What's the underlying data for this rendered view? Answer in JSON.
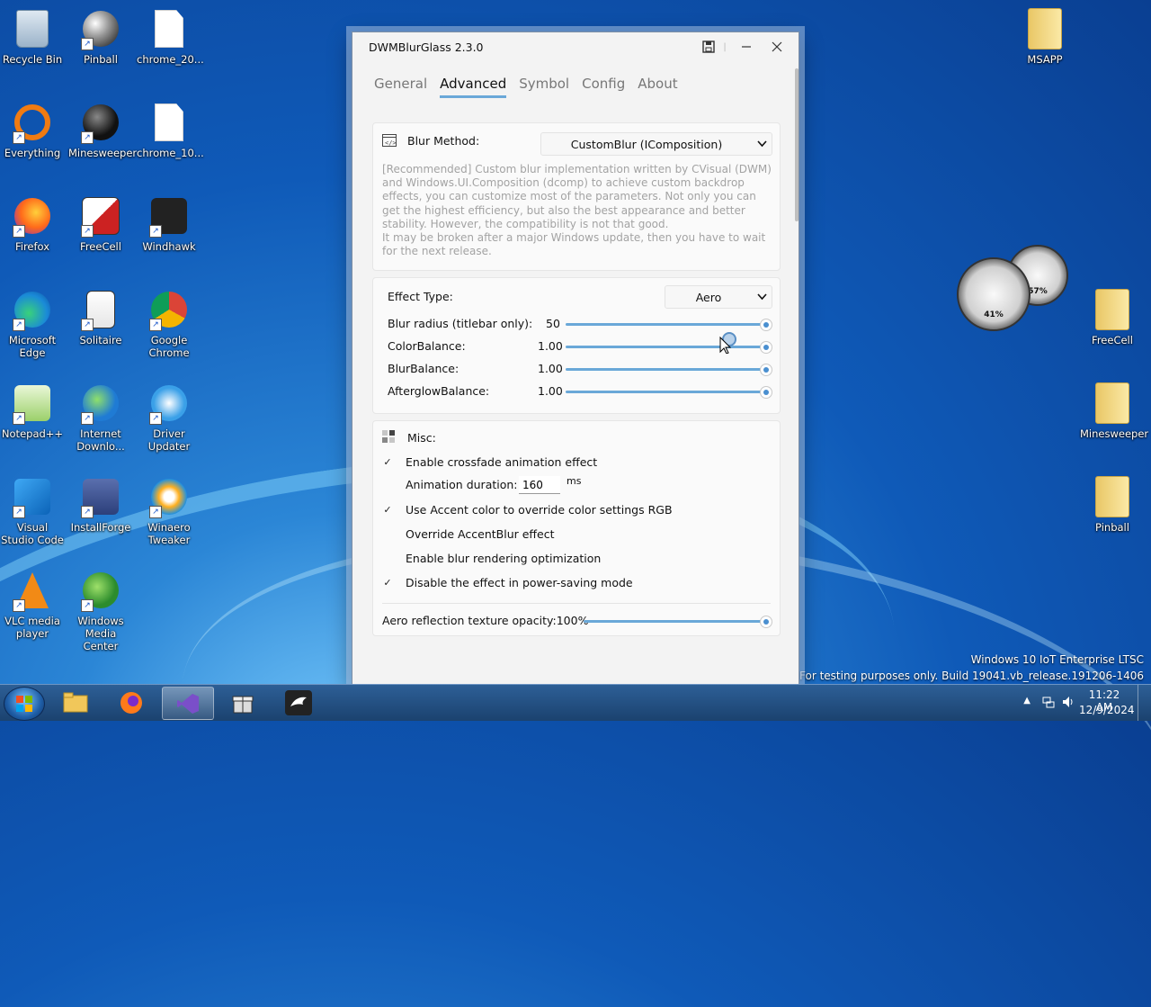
{
  "desktop": {
    "icons": [
      {
        "label": "Recycle Bin"
      },
      {
        "label": "Pinball"
      },
      {
        "label": "chrome_20..."
      },
      {
        "label": "Everything"
      },
      {
        "label": "Minesweeper"
      },
      {
        "label": "chrome_10..."
      },
      {
        "label": "Firefox"
      },
      {
        "label": "FreeCell"
      },
      {
        "label": "Windhawk"
      },
      {
        "label": "Microsoft Edge"
      },
      {
        "label": "Solitaire"
      },
      {
        "label": "Google Chrome"
      },
      {
        "label": "Notepad++"
      },
      {
        "label": "Internet Downlo..."
      },
      {
        "label": "Driver Updater"
      },
      {
        "label": "Visual Studio Code"
      },
      {
        "label": "InstallForge"
      },
      {
        "label": "Winaero Tweaker"
      },
      {
        "label": "VLC media player"
      },
      {
        "label": "Windows Media Center"
      }
    ],
    "right_icons": [
      {
        "label": "MSAPP"
      },
      {
        "label": "FreeCell"
      },
      {
        "label": "Minesweeper"
      },
      {
        "label": "Pinball"
      }
    ],
    "gauges": {
      "cpu": "41%",
      "mem": "57%"
    },
    "watermark": {
      "line1": "Windows 10 IoT Enterprise LTSC",
      "line2": "For testing purposes only. Build 19041.vb_release.191206-1406"
    }
  },
  "window": {
    "title": "DWMBlurGlass 2.3.0",
    "tabs": [
      {
        "label": "General"
      },
      {
        "label": "Advanced"
      },
      {
        "label": "Symbol"
      },
      {
        "label": "Config"
      },
      {
        "label": "About"
      }
    ],
    "active_tab": "Advanced",
    "blur": {
      "label": "Blur Method:",
      "value": "CustomBlur (IComposition)",
      "description": "[Recommended] Custom blur implementation written by CVisual (DWM) and Windows.UI.Composition (dcomp) to achieve custom backdrop effects, you can customize most of the parameters. Not only you can get the highest efficiency, but also the best appearance and better stability. However, the compatibility is not that good.\nIt may be broken after a major Windows update, then you have to wait for the next release."
    },
    "effect": {
      "label": "Effect Type:",
      "value": "Aero",
      "sliders": [
        {
          "label": "Blur radius (titlebar only):",
          "value": "50",
          "level": 1.0
        },
        {
          "label": "ColorBalance:",
          "value": "1.00",
          "level": 1.0
        },
        {
          "label": "BlurBalance:",
          "value": "1.00",
          "level": 1.0
        },
        {
          "label": "AfterglowBalance:",
          "value": "1.00",
          "level": 1.0
        }
      ]
    },
    "misc": {
      "label": "Misc:",
      "crossfade": {
        "label": "Enable crossfade animation effect",
        "checked": true
      },
      "duration": {
        "label": "Animation duration:",
        "value": "160",
        "unit": "ms"
      },
      "accent": {
        "label": "Use Accent color to override color settings RGB",
        "checked": true
      },
      "override": {
        "label": "Override AccentBlur effect",
        "checked": false
      },
      "optim": {
        "label": "Enable blur rendering optimization",
        "checked": false
      },
      "power": {
        "label": "Disable the effect in power-saving mode",
        "checked": true
      },
      "reflection": {
        "label": "Aero reflection texture opacity:100%",
        "level": 1.0
      }
    }
  },
  "taskbar": {
    "time": "11:22 AM",
    "date": "12/9/2024",
    "accent": "#2d5f96"
  }
}
